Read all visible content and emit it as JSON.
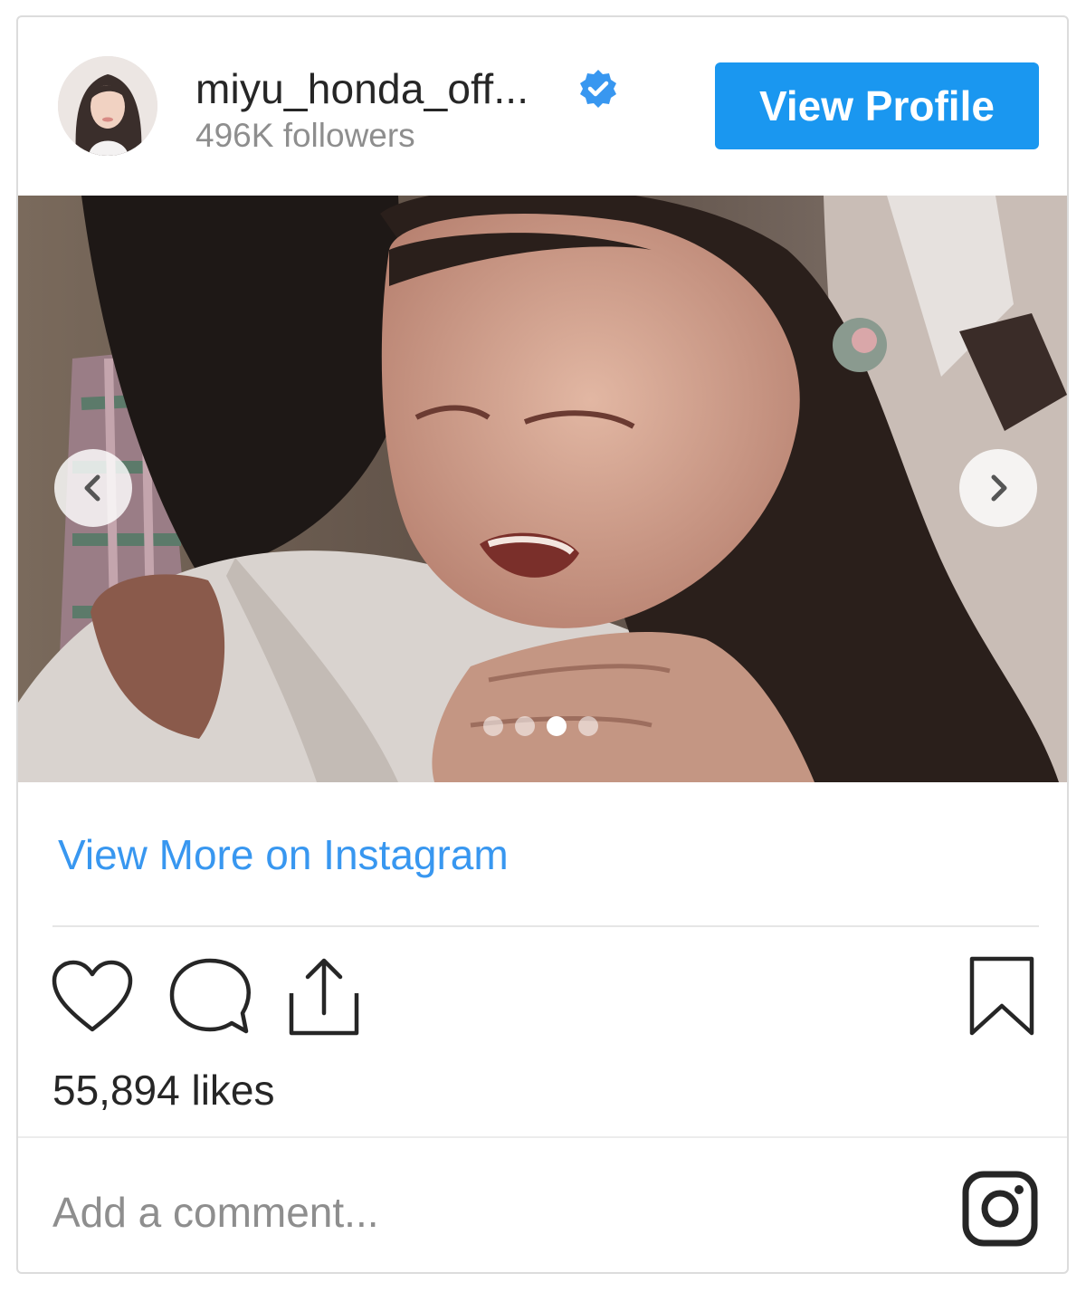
{
  "header": {
    "username": "miyu_honda_off...",
    "followers": "496K followers",
    "view_profile_label": "View Profile"
  },
  "carousel": {
    "slide_count": 4,
    "active_index": 2
  },
  "footer": {
    "view_more_label": "View More on Instagram",
    "likes": "55,894 likes",
    "comment_placeholder": "Add a comment..."
  },
  "colors": {
    "accent": "#1a97f0",
    "link": "#3897f0",
    "verified": "#3897f0"
  },
  "icons": [
    "verified-badge-icon",
    "chevron-left-icon",
    "chevron-right-icon",
    "heart-icon",
    "comment-icon",
    "share-icon",
    "bookmark-icon",
    "instagram-icon"
  ]
}
